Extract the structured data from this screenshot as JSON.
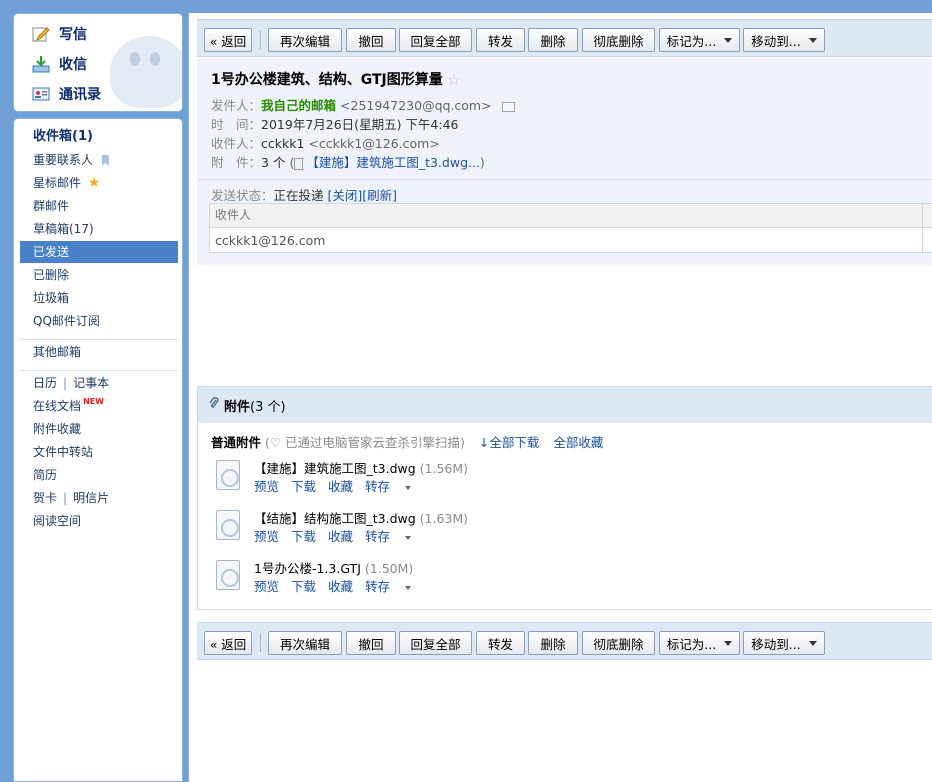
{
  "quick": [
    {
      "label": "写信",
      "icon": "pencil-icon"
    },
    {
      "label": "收信",
      "icon": "inbox-download-icon"
    },
    {
      "label": "通讯录",
      "icon": "contacts-card-icon"
    }
  ],
  "nav": {
    "inbox": "收件箱(1)",
    "important": "重要联系人",
    "starred": "星标邮件",
    "group": "群邮件",
    "drafts": "草稿箱(17)",
    "sent": "已发送",
    "deleted": "已删除",
    "spam": "垃圾箱",
    "subscription": "QQ邮件订阅",
    "other": "其他邮箱",
    "calendar": "日历",
    "notes": "记事本",
    "docs": "在线文档",
    "docs_badge": "NEW",
    "attach_fav": "附件收藏",
    "transfer": "文件中转站",
    "resume": "简历",
    "cards": "贺卡",
    "postcards": "明信片",
    "reading": "阅读空间"
  },
  "toolbar": {
    "back": "« 返回",
    "reedit": "再次编辑",
    "recall": "撤回",
    "reply_all": "回复全部",
    "forward": "转发",
    "delete": "删除",
    "perm_delete": "彻底删除",
    "mark_as": "标记为...",
    "move_to": "移动到..."
  },
  "mail": {
    "subject": "1号办公楼建筑、结构、GTJ图形算量",
    "from_label": "发件人：",
    "from_name": "我自己的邮箱",
    "from_addr": "<251947230@qq.com>",
    "time_label": "时　间：",
    "time": "2019年7月26日(星期五) 下午4:46",
    "to_label": "收件人：",
    "to_name": "cckkk1",
    "to_addr": "<cckkk1@126.com>",
    "attach_label": "附　件：",
    "attach_count": "3 个",
    "attach_preview": "【建施】建筑施工图_t3.dwg...",
    "send_status_label": "发送状态：",
    "send_status": "正在投递",
    "close_link": "[关闭]",
    "refresh_link": "[刷新]",
    "rcpt_header": "收件人",
    "rcpt_value": "cckkk1@126.com"
  },
  "attachments": {
    "title": "附件",
    "count": "(3 个)",
    "normal_label": "普通附件",
    "scan_note": "(♡ 已通过电脑管家云查杀引擎扫描)",
    "download_all": "全部下载",
    "save_all": "全部收藏",
    "actions": {
      "preview": "预览",
      "download": "下载",
      "favorite": "收藏",
      "save_to": "转存"
    },
    "files": [
      {
        "name": "【建施】建筑施工图_t3.dwg",
        "size": "(1.56M)"
      },
      {
        "name": "【结施】结构施工图_t3.dwg",
        "size": "(1.63M)"
      },
      {
        "name": "1号办公楼-1.3.GTJ",
        "size": "(1.50M)"
      }
    ]
  }
}
